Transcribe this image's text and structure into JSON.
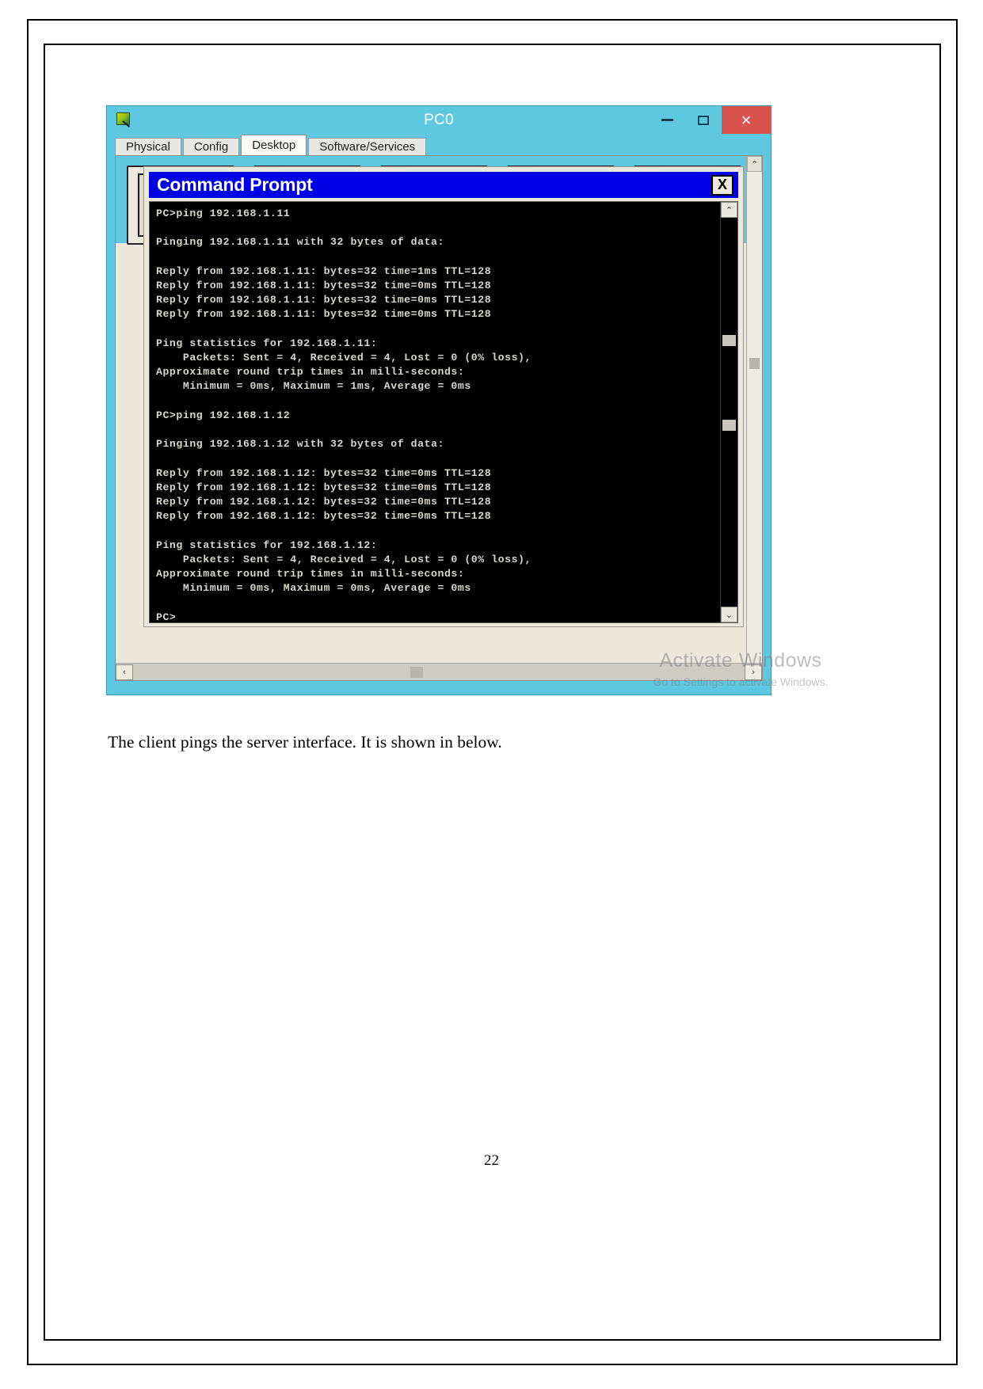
{
  "document": {
    "caption": "The client pings the server interface. It is shown in below.",
    "page_number": "22"
  },
  "pt_window": {
    "title": "PC0",
    "app_icon": "packet-tracer-icon",
    "window_buttons": {
      "minimize": "–",
      "maximize": "▭",
      "close": "×"
    },
    "tabs": [
      {
        "label": "Physical",
        "active": false
      },
      {
        "label": "Config",
        "active": false
      },
      {
        "label": "Desktop",
        "active": true
      },
      {
        "label": "Software/Services",
        "active": false
      }
    ],
    "scroll": {
      "up_arrow": "⌃",
      "down_arrow": "⌄",
      "left_arrow": "‹",
      "right_arrow": "›"
    }
  },
  "command_prompt": {
    "title": "Command Prompt",
    "close_label": "X",
    "scroll": {
      "up_arrow": "⌃",
      "down_arrow": "⌄"
    },
    "console_output": "PC>ping 192.168.1.11\n\nPinging 192.168.1.11 with 32 bytes of data:\n\nReply from 192.168.1.11: bytes=32 time=1ms TTL=128\nReply from 192.168.1.11: bytes=32 time=0ms TTL=128\nReply from 192.168.1.11: bytes=32 time=0ms TTL=128\nReply from 192.168.1.11: bytes=32 time=0ms TTL=128\n\nPing statistics for 192.168.1.11:\n    Packets: Sent = 4, Received = 4, Lost = 0 (0% loss),\nApproximate round trip times in milli-seconds:\n    Minimum = 0ms, Maximum = 1ms, Average = 0ms\n\nPC>ping 192.168.1.12\n\nPinging 192.168.1.12 with 32 bytes of data:\n\nReply from 192.168.1.12: bytes=32 time=0ms TTL=128\nReply from 192.168.1.12: bytes=32 time=0ms TTL=128\nReply from 192.168.1.12: bytes=32 time=0ms TTL=128\nReply from 192.168.1.12: bytes=32 time=0ms TTL=128\n\nPing statistics for 192.168.1.12:\n    Packets: Sent = 4, Received = 4, Lost = 0 (0% loss),\nApproximate round trip times in milli-seconds:\n    Minimum = 0ms, Maximum = 0ms, Average = 0ms\n\nPC>"
  },
  "watermark": {
    "line1": "Activate Windows",
    "line2": "Go to Settings to activate Windows."
  },
  "colors": {
    "pt_titlebar": "#5ec8e0",
    "close_button": "#d9534f",
    "cmd_titlebar": "#0000e6",
    "console_bg": "#000000",
    "console_text": "#d9d6cd",
    "panel_bg": "#ece9dc"
  }
}
